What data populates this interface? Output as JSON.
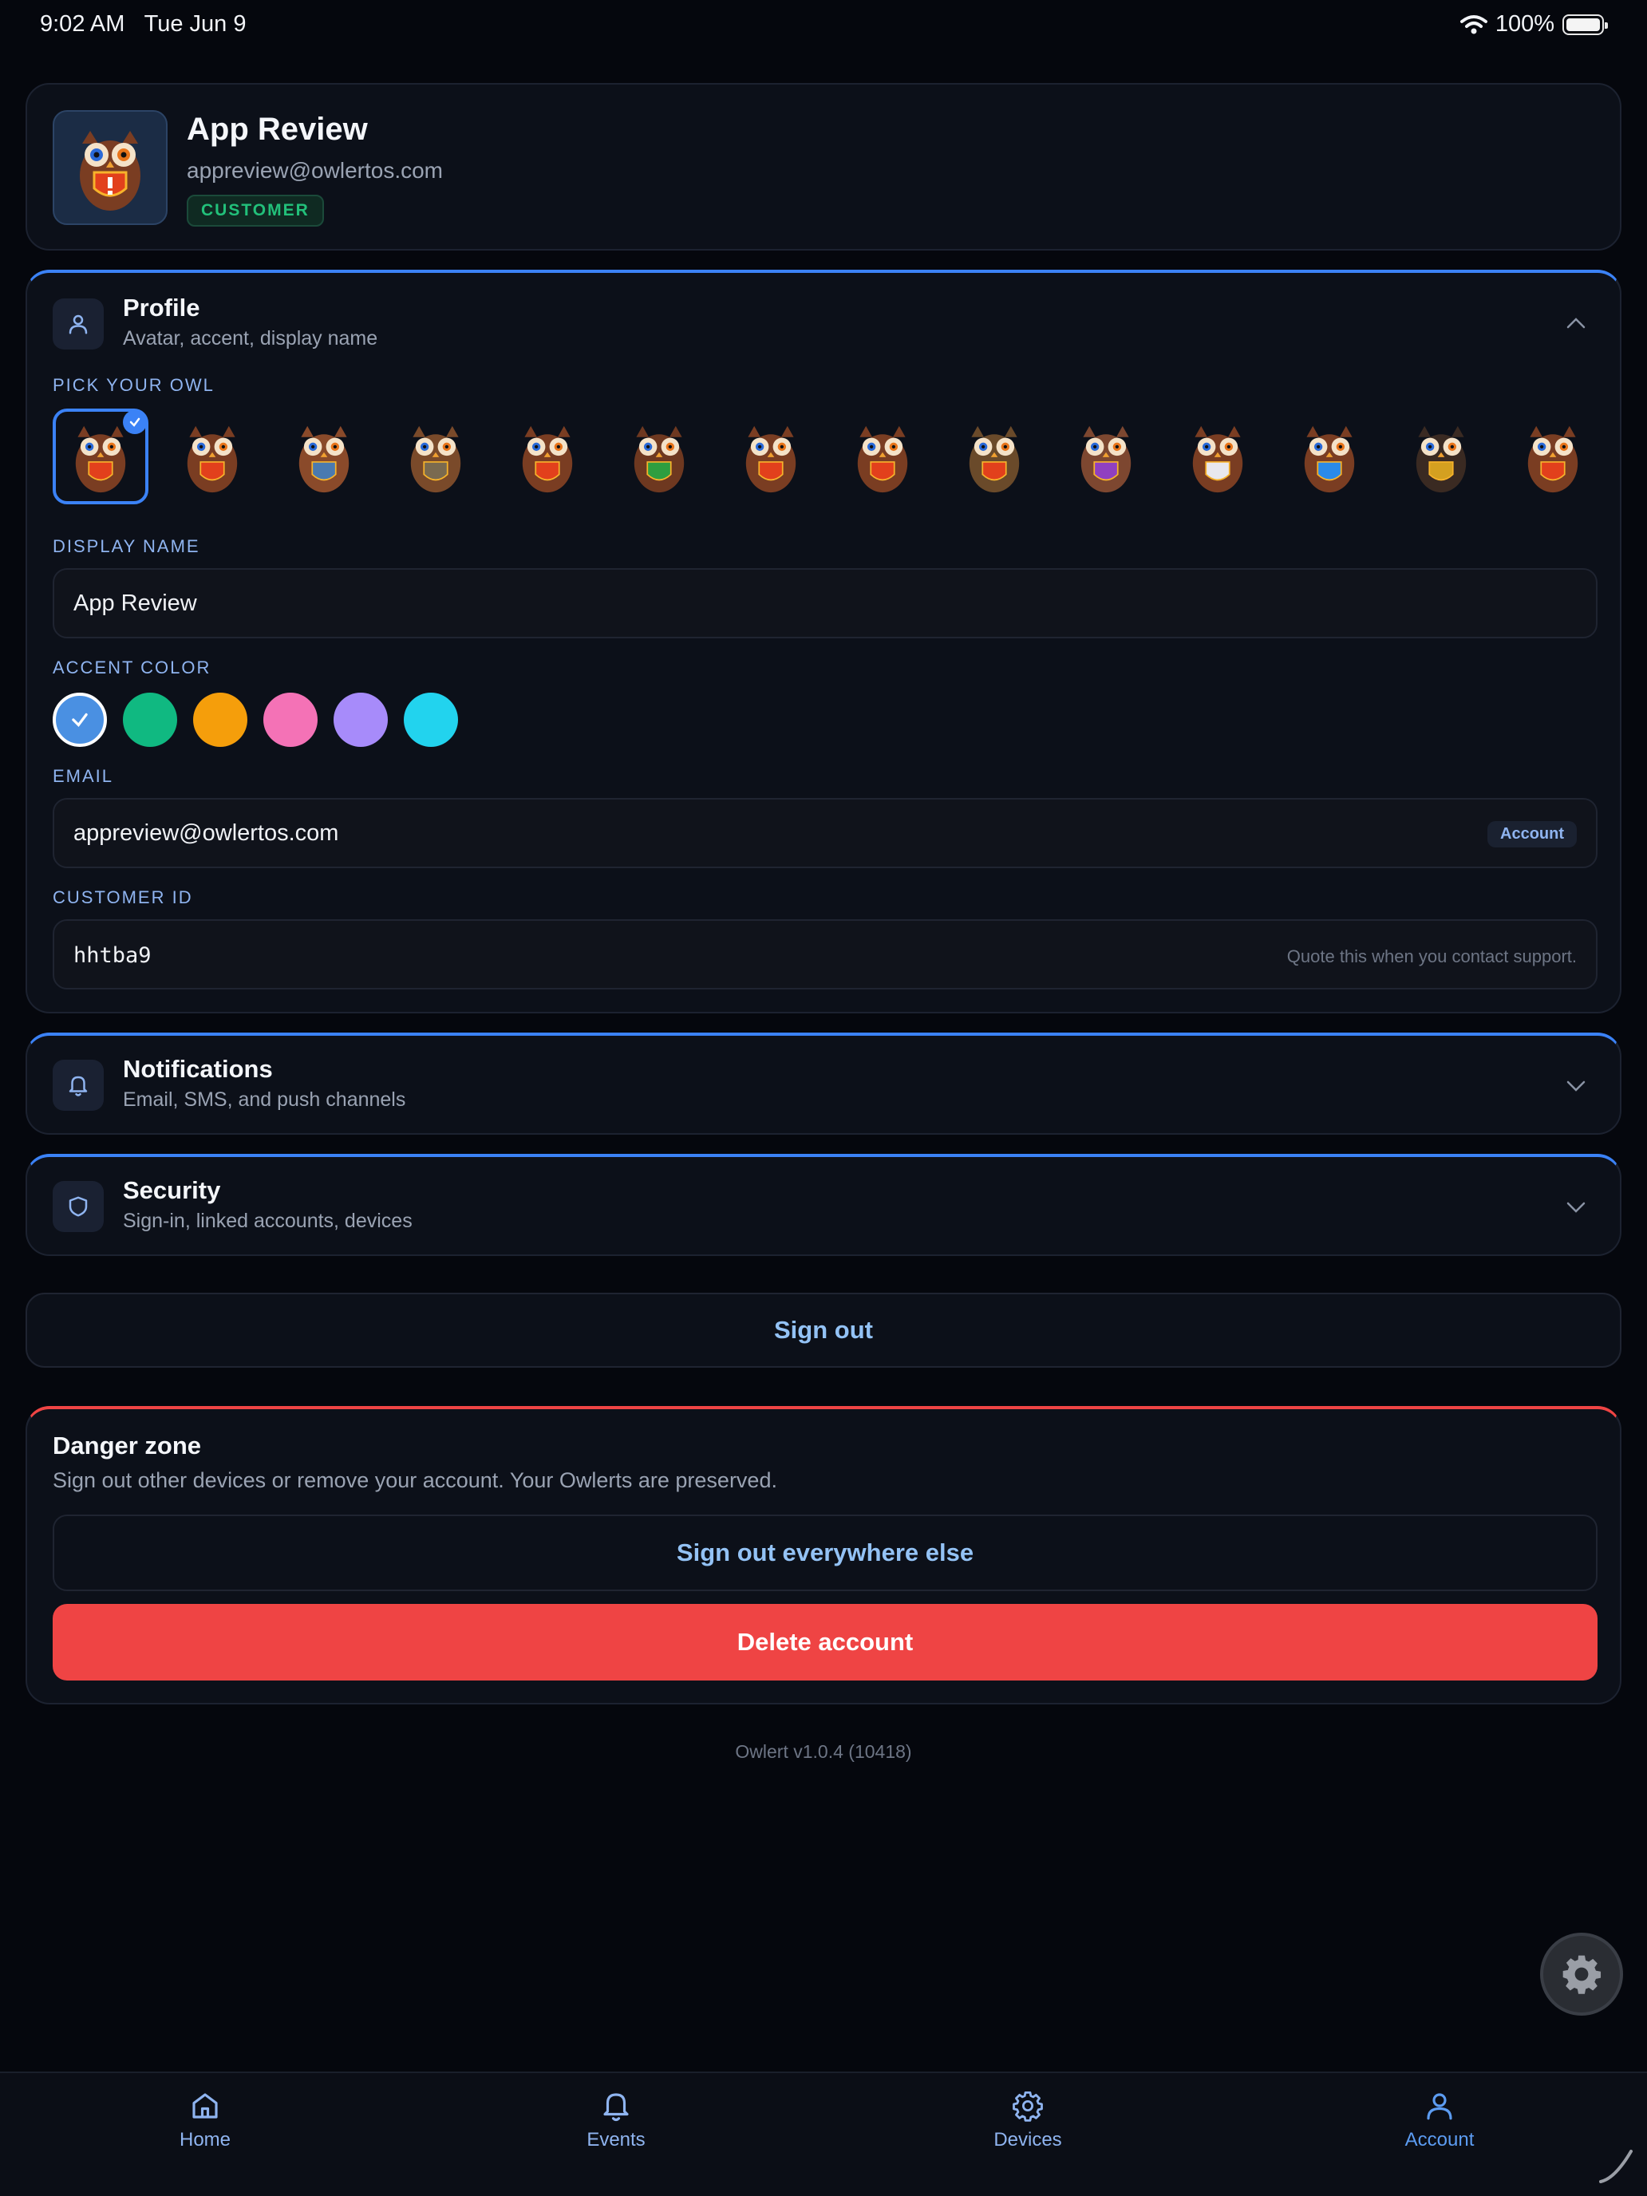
{
  "status_bar": {
    "time": "9:02 AM",
    "date": "Tue Jun 9",
    "battery": "100%"
  },
  "header": {
    "name": "App Review",
    "email": "appreview@owlertos.com",
    "badge": "CUSTOMER"
  },
  "profile": {
    "title": "Profile",
    "subtitle": "Avatar, accent, display name",
    "pick_owl_label": "PICK YOUR OWL",
    "owls": [
      "owl-shield",
      "owl-small",
      "owl-globe",
      "owl-perch",
      "owl-nest",
      "owl-green-shield",
      "owl-goggles",
      "owl-soldier",
      "owl-camo",
      "owl-purple",
      "owl-cloud",
      "owl-wifi",
      "owl-suit",
      "owl-police"
    ],
    "selected_owl_index": 0,
    "display_name_label": "DISPLAY NAME",
    "display_name": "App Review",
    "accent_label": "ACCENT COLOR",
    "accent_colors": [
      "#4a90e2",
      "#10b981",
      "#f59e0b",
      "#f472b6",
      "#a78bfa",
      "#22d3ee"
    ],
    "selected_accent_index": 0,
    "email_label": "EMAIL",
    "email": "appreview@owlertos.com",
    "email_tag": "Account",
    "customer_id_label": "CUSTOMER ID",
    "customer_id": "hhtba9",
    "customer_id_hint": "Quote this when you contact support."
  },
  "notifications": {
    "title": "Notifications",
    "subtitle": "Email, SMS, and push channels"
  },
  "security": {
    "title": "Security",
    "subtitle": "Sign-in, linked accounts, devices"
  },
  "sign_out_label": "Sign out",
  "danger_zone": {
    "title": "Danger zone",
    "description": "Sign out other devices or remove your account. Your Owlerts are preserved.",
    "sign_out_everywhere_label": "Sign out everywhere else",
    "delete_label": "Delete account"
  },
  "version": "Owlert v1.0.4 (10418)",
  "tabs": [
    {
      "label": "Home",
      "icon": "home-icon"
    },
    {
      "label": "Events",
      "icon": "bell-icon"
    },
    {
      "label": "Devices",
      "icon": "gear-icon"
    },
    {
      "label": "Account",
      "icon": "user-icon"
    }
  ],
  "active_tab": "Account"
}
